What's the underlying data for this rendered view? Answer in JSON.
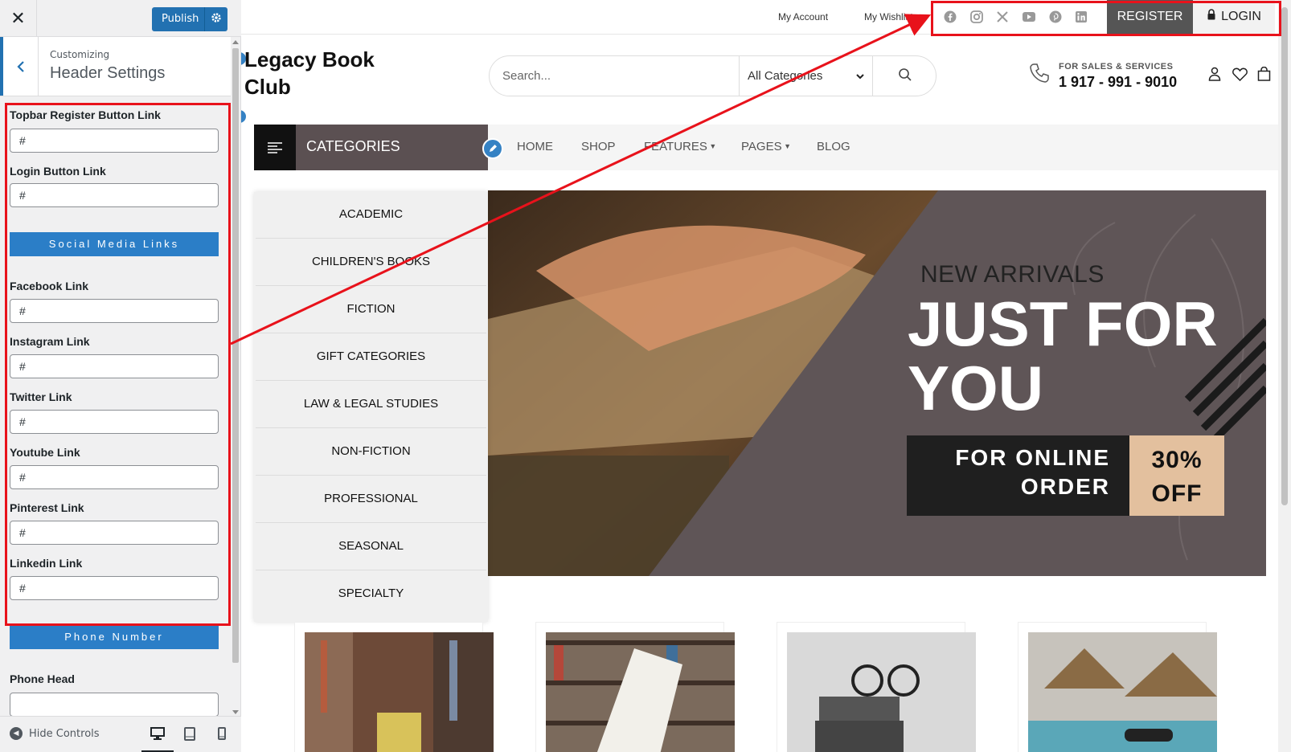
{
  "customizer": {
    "close_symbol": "✕",
    "publish_label": "Publish",
    "breadcrumb": "Customizing",
    "panel_title": "Header Settings",
    "fields": [
      {
        "label": "Topbar Register Button Link",
        "value": "#"
      },
      {
        "label": "Login Button Link",
        "value": "#"
      },
      {
        "label": "Facebook Link",
        "value": "#"
      },
      {
        "label": "Instagram Link",
        "value": "#"
      },
      {
        "label": "Twitter Link",
        "value": "#"
      },
      {
        "label": "Youtube Link",
        "value": "#"
      },
      {
        "label": "Pinterest Link",
        "value": "#"
      },
      {
        "label": "Linkedin Link",
        "value": "#"
      }
    ],
    "section_social": "Social Media Links",
    "section_phone": "Phone Number",
    "phone_head_label": "Phone Head",
    "hide_controls": "Hide Controls",
    "devices": [
      "desktop-icon",
      "tablet-icon",
      "mobile-icon"
    ],
    "accent_color": "#2271b1"
  },
  "site": {
    "topbar": {
      "my_account": "My Account",
      "my_wishlist": "My Wishlist",
      "social_icons": [
        "facebook-icon",
        "instagram-icon",
        "x-twitter-icon",
        "youtube-icon",
        "pinterest-icon",
        "linkedin-icon"
      ],
      "register": "REGISTER",
      "login": "LOGIN"
    },
    "logo_line1": "Legacy Book",
    "logo_line2": "Club",
    "search": {
      "placeholder": "Search...",
      "category": "All Categories"
    },
    "sales_label": "FOR SALES & SERVICES",
    "phone": "1 917 - 991 - 9010",
    "nav": {
      "categories_label": "CATEGORIES",
      "items": [
        "HOME",
        "SHOP",
        "FEATURES",
        "PAGES",
        "BLOG"
      ]
    },
    "categories": [
      "ACADEMIC",
      "CHILDREN'S BOOKS",
      "FICTION",
      "GIFT CATEGORIES",
      "LAW & LEGAL STUDIES",
      "NON-FICTION",
      "PROFESSIONAL",
      "SEASONAL",
      "SPECIALTY"
    ],
    "hero": {
      "subtitle": "NEW ARRIVALS",
      "title_line1": "JUST FOR",
      "title_line2": "YOU",
      "promo_line1": "FOR ONLINE",
      "promo_line2": "ORDER",
      "discount_line1": "30%",
      "discount_line2": "OFF"
    },
    "annotation_color": "#e8121b"
  }
}
